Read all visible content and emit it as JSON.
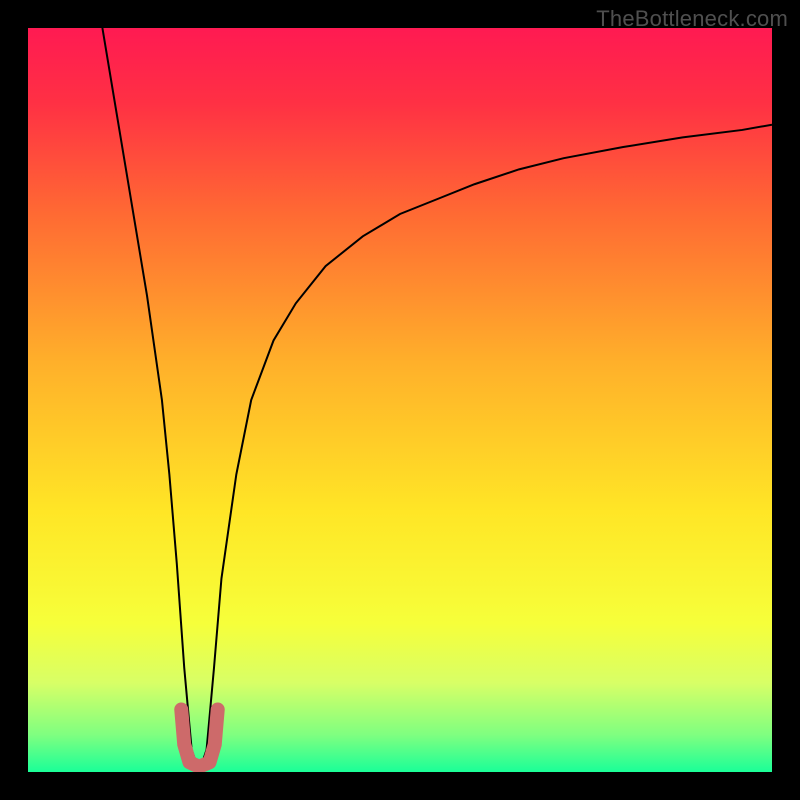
{
  "watermark": "TheBottleneck.com",
  "chart_data": {
    "type": "line",
    "title": "",
    "xlabel": "",
    "ylabel": "",
    "xlim": [
      0,
      100
    ],
    "ylim": [
      0,
      100
    ],
    "legend": false,
    "grid": false,
    "background": {
      "type": "vertical-gradient",
      "stops": [
        {
          "pos": 0.0,
          "color": "#ff1a52"
        },
        {
          "pos": 0.1,
          "color": "#ff3044"
        },
        {
          "pos": 0.25,
          "color": "#ff6a33"
        },
        {
          "pos": 0.45,
          "color": "#ffb02a"
        },
        {
          "pos": 0.65,
          "color": "#ffe626"
        },
        {
          "pos": 0.8,
          "color": "#f6ff3a"
        },
        {
          "pos": 0.88,
          "color": "#d8ff66"
        },
        {
          "pos": 0.95,
          "color": "#7fff80"
        },
        {
          "pos": 1.0,
          "color": "#1aff98"
        }
      ]
    },
    "series": [
      {
        "name": "bottleneck-curve",
        "color": "#000000",
        "stroke_width": 2,
        "x": [
          10,
          12,
          14,
          16,
          18,
          19,
          20,
          21,
          22,
          23,
          24,
          25,
          26,
          28,
          30,
          33,
          36,
          40,
          45,
          50,
          55,
          60,
          66,
          72,
          80,
          88,
          96,
          100
        ],
        "y": [
          100,
          88,
          76,
          64,
          50,
          40,
          28,
          14,
          3,
          0,
          3,
          14,
          26,
          40,
          50,
          58,
          63,
          68,
          72,
          75,
          77,
          79,
          81,
          82.5,
          84,
          85.3,
          86.3,
          87
        ]
      },
      {
        "name": "minimum-marker",
        "color": "#cd6a6a",
        "stroke_width": 14,
        "stroke_linecap": "round",
        "x": [
          20.6,
          21.0,
          21.7,
          23.0,
          24.4,
          25.1,
          25.5
        ],
        "y": [
          8.4,
          3.7,
          1.3,
          0.7,
          1.3,
          3.7,
          8.4
        ]
      }
    ],
    "annotations": []
  }
}
